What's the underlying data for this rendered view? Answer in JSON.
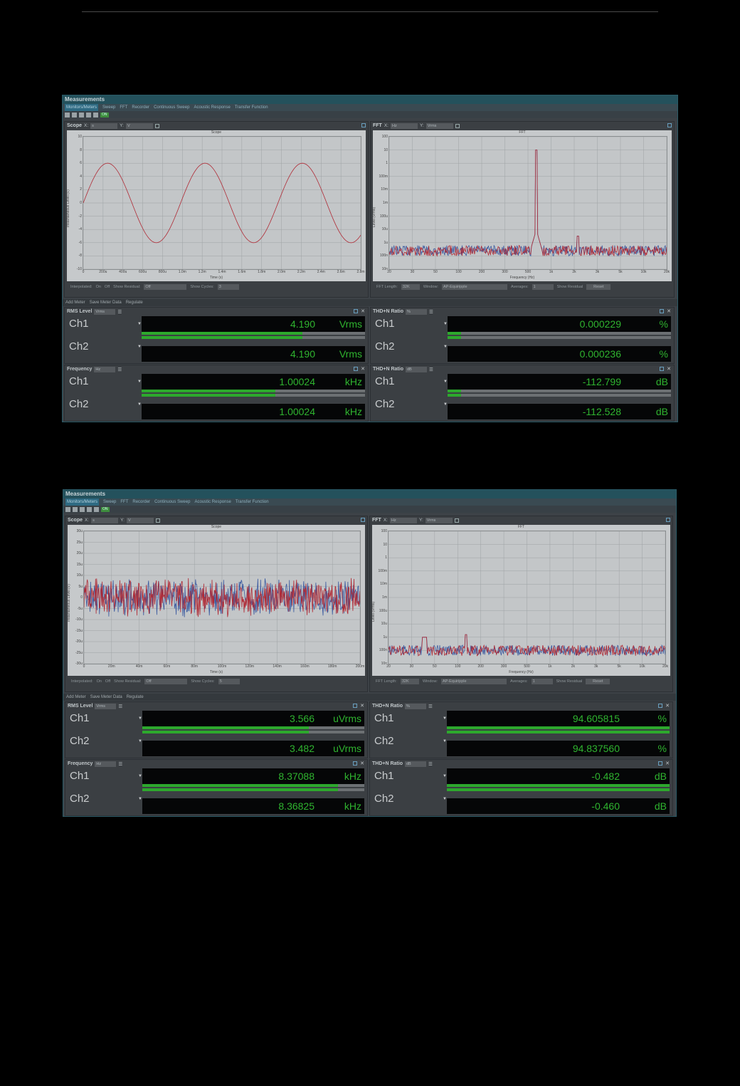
{
  "window_title": "Measurements",
  "menu": [
    "Monitors/Meters",
    "Sweep",
    "FFT",
    "Recorder",
    "Continuous Sweep",
    "Acoustic Response",
    "Transfer Function"
  ],
  "on_badge": "ON",
  "colors": {
    "meter_text": "#2fb42f",
    "ch1_trace": "#3b5aa0",
    "ch2_trace": "#b02a35"
  },
  "panels": [
    {
      "scope": {
        "label": "Scope",
        "x_axis_label": "X:",
        "x_unit": "s",
        "y_axis_label": "Y:",
        "y_unit": "V",
        "plot_title": "Scope",
        "xlabel": "Time (s)",
        "ylabel": "Instantaneous Level (V)",
        "yticks": [
          "10",
          "8",
          "6",
          "4",
          "2",
          "0",
          "-2",
          "-4",
          "-6",
          "-8",
          "-10"
        ],
        "xticks": [
          "0",
          "200u",
          "400u",
          "600u",
          "800u",
          "1.0m",
          "1.2m",
          "1.4m",
          "1.6m",
          "1.8m",
          "2.0m",
          "2.2m",
          "2.4m",
          "2.6m",
          "2.8m"
        ],
        "controls": {
          "interpolated": "Interpolated:",
          "on": "On",
          "off": "Off",
          "show_residual": "Show Residual:",
          "residual_value": "Off",
          "show_cycles": "Show Cycles:",
          "cycles_value": "3"
        }
      },
      "fft": {
        "label": "FFT",
        "x_axis_label": "X:",
        "x_unit": "Hz",
        "y_axis_label": "Y:",
        "y_unit": "Vrms",
        "plot_title": "FFT",
        "xlabel": "Frequency (Hz)",
        "ylabel": "Level (Vrms)",
        "yticks": [
          "100",
          "10",
          "1",
          "100m",
          "10m",
          "1m",
          "100u",
          "10u",
          "1u",
          "100n",
          "10n"
        ],
        "xticks": [
          "20",
          "30",
          "50",
          "100",
          "200",
          "300",
          "500",
          "1k",
          "2k",
          "3k",
          "5k",
          "10k",
          "20k"
        ],
        "controls": {
          "fft_length": "FFT Length:",
          "fft_length_value": "32K",
          "window": "Window:",
          "window_value": "AP-Equiripple",
          "averages": "Averages:",
          "averages_value": "1",
          "show_residual": "Show Residual",
          "reset": "Reset"
        }
      },
      "meter_toolbar": {
        "add_meter": "Add Meter",
        "save_meter_data": "Save Meter Data",
        "regulate": "Regulate"
      },
      "meters": [
        {
          "title": "RMS Level",
          "unit_select": "Vrms",
          "channels": [
            {
              "name": "Ch1",
              "value": "4.190",
              "unit": "Vrms",
              "level": 0.72
            },
            {
              "name": "Ch2",
              "value": "4.190",
              "unit": "Vrms",
              "level": 0.72
            }
          ]
        },
        {
          "title": "THD+N Ratio",
          "unit_select": "%",
          "channels": [
            {
              "name": "Ch1",
              "value": "0.000229",
              "unit": "%",
              "level": 0.06
            },
            {
              "name": "Ch2",
              "value": "0.000236",
              "unit": "%",
              "level": 0.06
            }
          ]
        },
        {
          "title": "Frequency",
          "unit_select": "Hz",
          "channels": [
            {
              "name": "Ch1",
              "value": "1.00024",
              "unit": "kHz",
              "level": 0.6
            },
            {
              "name": "Ch2",
              "value": "1.00024",
              "unit": "kHz",
              "level": 0.6
            }
          ]
        },
        {
          "title": "THD+N Ratio",
          "unit_select": "dB",
          "channels": [
            {
              "name": "Ch1",
              "value": "-112.799",
              "unit": "dB",
              "level": 0.06
            },
            {
              "name": "Ch2",
              "value": "-112.528",
              "unit": "dB",
              "level": 0.06
            }
          ]
        }
      ]
    },
    {
      "scope": {
        "label": "Scope",
        "x_axis_label": "X:",
        "x_unit": "s",
        "y_axis_label": "Y:",
        "y_unit": "V",
        "plot_title": "Scope",
        "xlabel": "Time (s)",
        "ylabel": "Instantaneous Level (V)",
        "yticks": [
          "30u",
          "25u",
          "20u",
          "15u",
          "10u",
          "5u",
          "0",
          "-5u",
          "-10u",
          "-15u",
          "-20u",
          "-25u",
          "-30u"
        ],
        "xticks": [
          "0",
          "20m",
          "40m",
          "60m",
          "80m",
          "100m",
          "120m",
          "140m",
          "160m",
          "180m",
          "200m"
        ],
        "controls": {
          "interpolated": "Interpolated:",
          "on": "On",
          "off": "Off",
          "show_residual": "Show Residual:",
          "residual_value": "Off",
          "show_cycles": "Show Cycles:",
          "cycles_value": "5"
        }
      },
      "fft": {
        "label": "FFT",
        "x_axis_label": "X:",
        "x_unit": "Hz",
        "y_axis_label": "Y:",
        "y_unit": "Vrms",
        "plot_title": "FFT",
        "xlabel": "Frequency (Hz)",
        "ylabel": "Level (Vrms)",
        "yticks": [
          "100",
          "10",
          "1",
          "100m",
          "10m",
          "1m",
          "100u",
          "10u",
          "1u",
          "100n",
          "10n"
        ],
        "xticks": [
          "20",
          "30",
          "50",
          "100",
          "200",
          "300",
          "500",
          "1k",
          "2k",
          "3k",
          "5k",
          "10k",
          "20k"
        ],
        "controls": {
          "fft_length": "FFT Length:",
          "fft_length_value": "32K",
          "window": "Window:",
          "window_value": "AP-Equiripple",
          "averages": "Averages:",
          "averages_value": "1",
          "show_residual": "Show Residual",
          "reset": "Reset"
        }
      },
      "meter_toolbar": {
        "add_meter": "Add Meter",
        "save_meter_data": "Save Meter Data",
        "regulate": "Regulate"
      },
      "meters": [
        {
          "title": "RMS Level",
          "unit_select": "Vrms",
          "channels": [
            {
              "name": "Ch1",
              "value": "3.566",
              "unit": "uVrms",
              "level": 0.75
            },
            {
              "name": "Ch2",
              "value": "3.482",
              "unit": "uVrms",
              "level": 0.75
            }
          ]
        },
        {
          "title": "THD+N Ratio",
          "unit_select": "%",
          "channels": [
            {
              "name": "Ch1",
              "value": "94.605815",
              "unit": "%",
              "level": 1.0
            },
            {
              "name": "Ch2",
              "value": "94.837560",
              "unit": "%",
              "level": 1.0
            }
          ]
        },
        {
          "title": "Frequency",
          "unit_select": "Hz",
          "channels": [
            {
              "name": "Ch1",
              "value": "8.37088",
              "unit": "kHz",
              "level": 0.88
            },
            {
              "name": "Ch2",
              "value": "8.36825",
              "unit": "kHz",
              "level": 0.88
            }
          ]
        },
        {
          "title": "THD+N Ratio",
          "unit_select": "dB",
          "channels": [
            {
              "name": "Ch1",
              "value": "-0.482",
              "unit": "dB",
              "level": 1.0
            },
            {
              "name": "Ch2",
              "value": "-0.460",
              "unit": "dB",
              "level": 1.0
            }
          ]
        }
      ]
    }
  ]
}
